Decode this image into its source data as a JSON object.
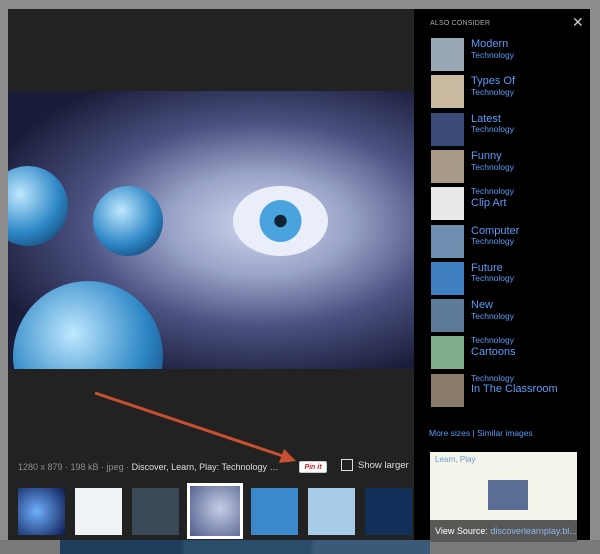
{
  "viewer": {
    "meta": "1280 x 879 · 198 kB · jpeg · ",
    "title": "Discover, Learn, Play: Technology …",
    "pin_label": "Pin it",
    "show_larger": "Show larger"
  },
  "sidebar": {
    "heading": "ALSO CONSIDER",
    "close": "✕",
    "items": [
      {
        "a": "Modern",
        "b": "Technology",
        "top": true
      },
      {
        "a": "Types Of",
        "b": "Technology",
        "top": true
      },
      {
        "a": "Latest",
        "b": "Technology",
        "top": true
      },
      {
        "a": "Funny",
        "b": "Technology",
        "top": true
      },
      {
        "a": "Technology",
        "b": "Clip Art",
        "top": false
      },
      {
        "a": "Computer",
        "b": "Technology",
        "top": true
      },
      {
        "a": "Future",
        "b": "Technology",
        "top": true
      },
      {
        "a": "New",
        "b": "Technology",
        "top": true
      },
      {
        "a": "Technology",
        "b": "Cartoons",
        "top": false
      },
      {
        "a": "Technology",
        "b": "In The Classroom",
        "top": false
      }
    ],
    "more_sizes": "More sizes",
    "sep": " | ",
    "similar": "Similar images",
    "source_label": "View Source:",
    "source_site": "discoverlearnplay.bl...",
    "preview_title": "Learn, Play"
  },
  "colors": {
    "link": "#5b9bf5",
    "arrow": "#c9502e"
  }
}
